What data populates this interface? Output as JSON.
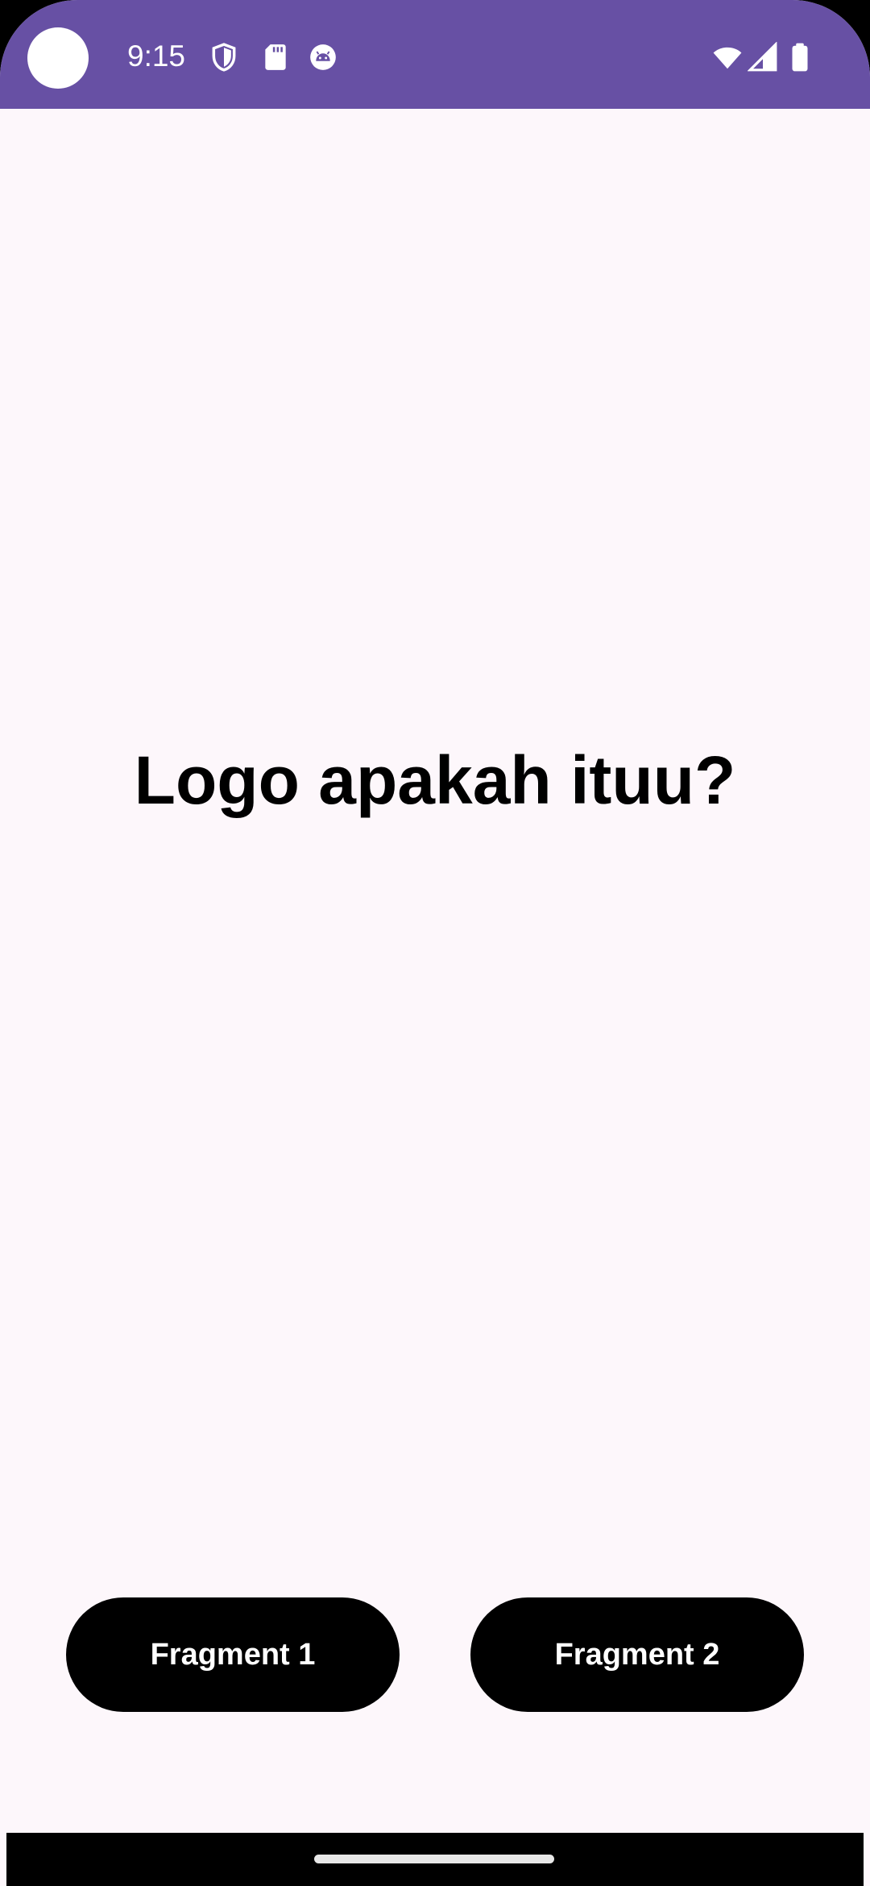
{
  "status_bar": {
    "time": "9:15",
    "left_icons": [
      "shield-icon",
      "sd-card-icon",
      "android-debug-icon"
    ],
    "right_icons": [
      "wifi-icon",
      "cell-signal-icon",
      "battery-icon"
    ],
    "background_color": "#6750a4"
  },
  "main": {
    "headline": "Logo apakah ituu?"
  },
  "buttons": {
    "fragment_1_label": "Fragment 1",
    "fragment_2_label": "Fragment 2",
    "background_color": "#000000",
    "text_color": "#ffffff"
  },
  "nav_bar": {
    "handle": "gesture-handle"
  },
  "colors": {
    "page_background": "#fdf7fb",
    "accent": "#6750a4"
  }
}
